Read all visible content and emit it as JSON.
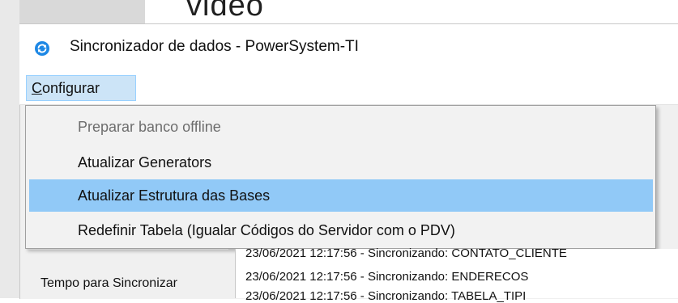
{
  "background": {
    "partial_heading": "video"
  },
  "window": {
    "title": "Sincronizador de dados - PowerSystem-TI",
    "app_icon": "sync-icon"
  },
  "menubar": {
    "configurar_mnemonic": "C",
    "configurar_rest": "onfigurar"
  },
  "dropdown": {
    "items": [
      {
        "label": "Preparar banco offline",
        "enabled": false
      },
      {
        "label": "Atualizar Generators",
        "enabled": true
      },
      {
        "label": "Atualizar Estrutura das Bases",
        "enabled": true,
        "highlighted": true
      },
      {
        "label": "Redefinir Tabela (Igualar Códigos do Servidor com o PDV)",
        "enabled": true
      }
    ]
  },
  "sync_group": {
    "label": "Tempo para Sincronizar"
  },
  "log": {
    "lines": [
      "23/06/2021 12:17:56 - Sincronizando: CONTATO_CLIENTE",
      "23/06/2021 12:17:56 - Sincronizando: ENDERECOS",
      "23/06/2021 12:17:56 - Sincronizando: TABELA_TIPI"
    ]
  },
  "colors": {
    "highlight": "#91c9f7",
    "menu_active": "#cce4f7",
    "disabled_text": "#6d6d6d",
    "icon_blue": "#1e88e5"
  }
}
